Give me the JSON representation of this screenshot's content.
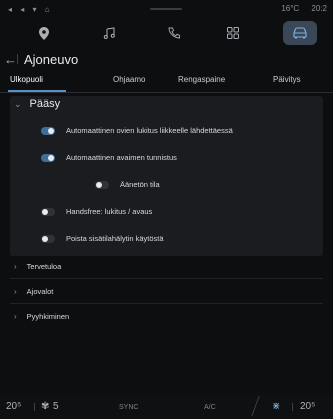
{
  "status": {
    "left_icons": "◂ ◂ ▾ ⌂",
    "temp": "16°C",
    "time": "20:2"
  },
  "topnav": {
    "icons": [
      "location-pin-icon",
      "music-icon",
      "phone-icon",
      "apps-grid-icon",
      "car-icon"
    ],
    "active": "car-icon"
  },
  "header": {
    "title": "Ajoneuvo"
  },
  "tabs": [
    {
      "label": "Ulkopuoli",
      "selected": true
    },
    {
      "label": "Ohjaamo",
      "selected": false
    },
    {
      "label": "Rengaspaine",
      "selected": false
    },
    {
      "label": "Päivitys",
      "selected": false
    }
  ],
  "section": {
    "title": "Pääsy",
    "options": [
      {
        "label": "Automaattinen ovien lukitus liikkeelle lähdettäessä",
        "on": true
      },
      {
        "label": "Automaattinen avaimen tunnistus",
        "on": true
      },
      {
        "label": "Äänetön tila",
        "on": false
      },
      {
        "label": "Handsfree: lukitus / avaus",
        "on": false
      },
      {
        "label": "Poista sisätilahälytin käytöstä",
        "on": false
      }
    ]
  },
  "collapsed": [
    "Tervetuloa",
    "Ajovalot",
    "Pyyhkiminen"
  ],
  "bottom": {
    "left_temp": "20⁵",
    "fan": "5",
    "sync": "SYNC",
    "ac": "A/C",
    "right_temp": "20⁵"
  },
  "colors": {
    "accent": "#5a8fc4",
    "panel": "#1a1c1f",
    "background": "#0d0e10"
  }
}
